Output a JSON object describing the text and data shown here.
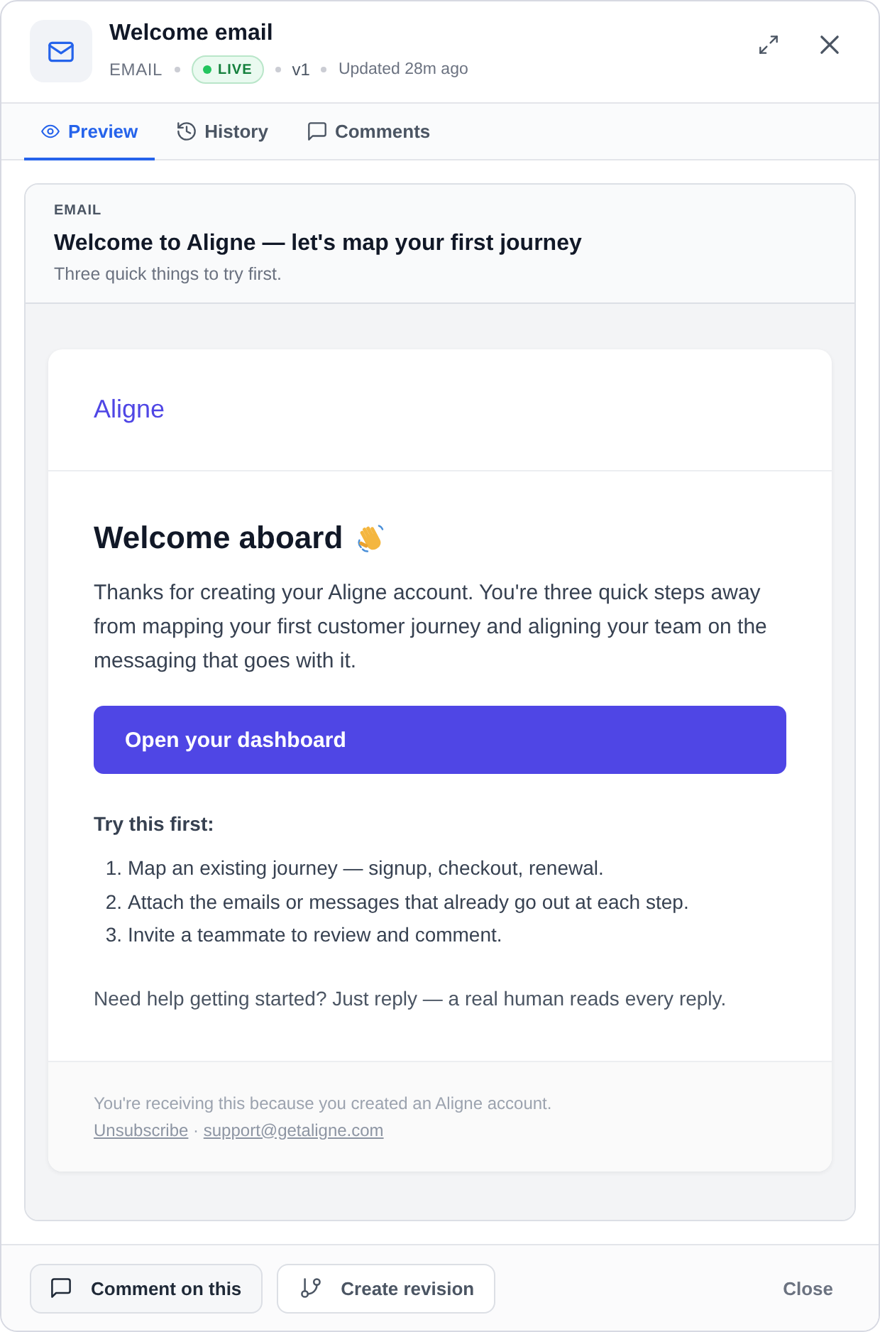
{
  "window": {
    "title": "Welcome email",
    "type": "EMAIL",
    "status": "LIVE",
    "version": "v1",
    "updated": "Updated 28m ago"
  },
  "tabs": [
    {
      "label": "Preview",
      "selected": true
    },
    {
      "label": "History",
      "selected": false
    },
    {
      "label": "Comments",
      "selected": false
    }
  ],
  "preview": {
    "label": "EMAIL",
    "subject": "Welcome to Aligne — let's map your first journey",
    "preheader": "Three quick things to try first.",
    "email": {
      "brand": "Aligne",
      "heading": "Welcome aboard",
      "paragraph": "Thanks for creating your Aligne account. You're three quick steps away from mapping your first customer journey and aligning your team on the messaging that goes with it.",
      "cta": "Open your dashboard",
      "list_title": "Try this first:",
      "steps": [
        {
          "marker": "1.",
          "text": "Map an existing journey — signup, checkout, renewal."
        },
        {
          "marker": "2.",
          "text": "Attach the emails or messages that already go out at each step."
        },
        {
          "marker": "3.",
          "text": "Invite a teammate to review and comment."
        }
      ],
      "closing": "Need help getting started? Just reply — a real human reads every reply.",
      "footer_note": "You're receiving this because you created an Aligne account.",
      "footer_links": [
        "Unsubscribe",
        "support@getaligne.com"
      ],
      "footer_separator": "·"
    }
  },
  "footer": {
    "buttons": [
      {
        "label": "Comment on this",
        "kind": "tinted"
      },
      {
        "label": "Create revision",
        "kind": "outline"
      }
    ],
    "close": "Close"
  }
}
